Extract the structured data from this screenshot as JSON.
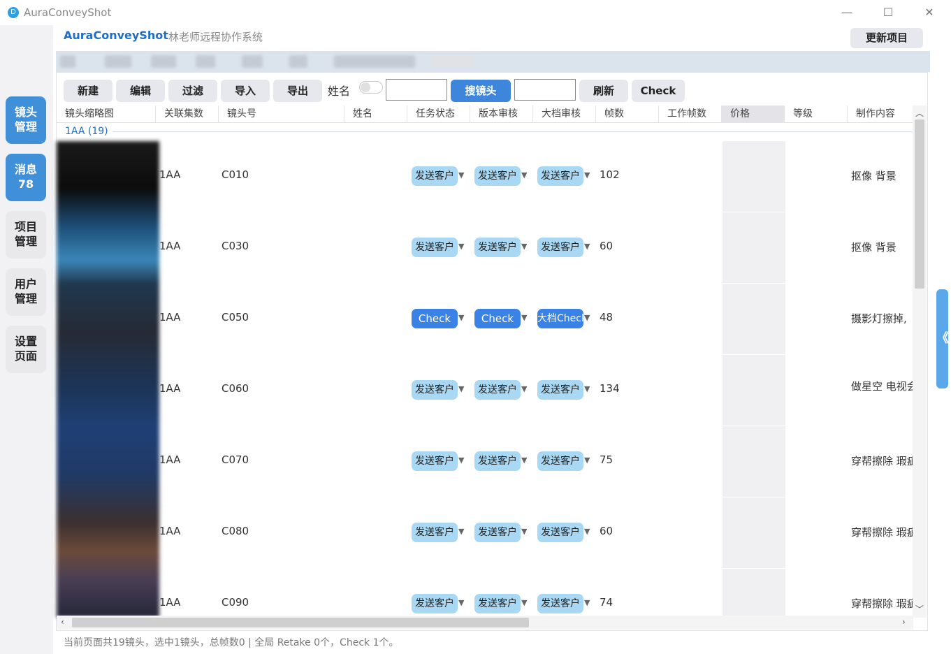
{
  "window": {
    "title": "AuraConveyShot",
    "minimize": "—",
    "maximize": "☐",
    "close": "✕",
    "logo": "D"
  },
  "header": {
    "brand": "AuraConveyShot",
    "subtitle": "林老师远程协作系统",
    "update_button": "更新项目"
  },
  "sidebar": [
    {
      "line1": "镜头",
      "line2": "管理",
      "active": true
    },
    {
      "line1": "消息",
      "line2": "78",
      "active": true
    },
    {
      "line1": "项目",
      "line2": "管理",
      "active": false
    },
    {
      "line1": "用户",
      "line2": "管理",
      "active": false
    },
    {
      "line1": "设置",
      "line2": "页面",
      "active": false
    }
  ],
  "toolbar": {
    "new": "新建",
    "edit": "编辑",
    "filter": "过滤",
    "import": "导入",
    "export": "导出",
    "name_label": "姓名",
    "search_shot": "搜镜头",
    "refresh": "刷新",
    "check": "Check",
    "input1_value": "",
    "input2_value": ""
  },
  "columns": [
    "镜头缩略图",
    "关联集数",
    "镜头号",
    "姓名",
    "任务状态",
    "版本审核",
    "大档审核",
    "帧数",
    "工作帧数",
    "价格",
    "等级",
    "制作内容"
  ],
  "group": {
    "label": "1AA (19)"
  },
  "rows": [
    {
      "episode": "1AA",
      "shot": "C010",
      "name": "",
      "task": "发送客户",
      "version": "发送客户",
      "master": "发送客户",
      "frames": "102",
      "content": "抠像  背景"
    },
    {
      "episode": "1AA",
      "shot": "C030",
      "name": "",
      "task": "发送客户",
      "version": "发送客户",
      "master": "发送客户",
      "frames": "60",
      "content": "抠像  背景"
    },
    {
      "episode": "1AA",
      "shot": "C050",
      "name": "",
      "task": "Check",
      "version": "Check",
      "master": "大档Check",
      "frames": "48",
      "content": "摄影灯擦掉,"
    },
    {
      "episode": "1AA",
      "shot": "C060",
      "name": "",
      "task": "发送客户",
      "version": "发送客户",
      "master": "发送客户",
      "frames": "134",
      "content": "做星空 电视会"
    },
    {
      "episode": "1AA",
      "shot": "C070",
      "name": "",
      "task": "发送客户",
      "version": "发送客户",
      "master": "发送客户",
      "frames": "75",
      "content": "穿帮擦除 瑕疵"
    },
    {
      "episode": "1AA",
      "shot": "C080",
      "name": "",
      "task": "发送客户",
      "version": "发送客户",
      "master": "发送客户",
      "frames": "60",
      "content": "穿帮擦除 瑕疵"
    },
    {
      "episode": "1AA",
      "shot": "C090",
      "name": "",
      "task": "发送客户",
      "version": "发送客户",
      "master": "发送客户",
      "frames": "74",
      "content": "穿帮擦除 瑕疵"
    }
  ],
  "statusbar": "当前页面共19镜头，选中1镜头，总帧数0 | 全局 Retake 0个，Check 1个。",
  "side_handle": "《"
}
